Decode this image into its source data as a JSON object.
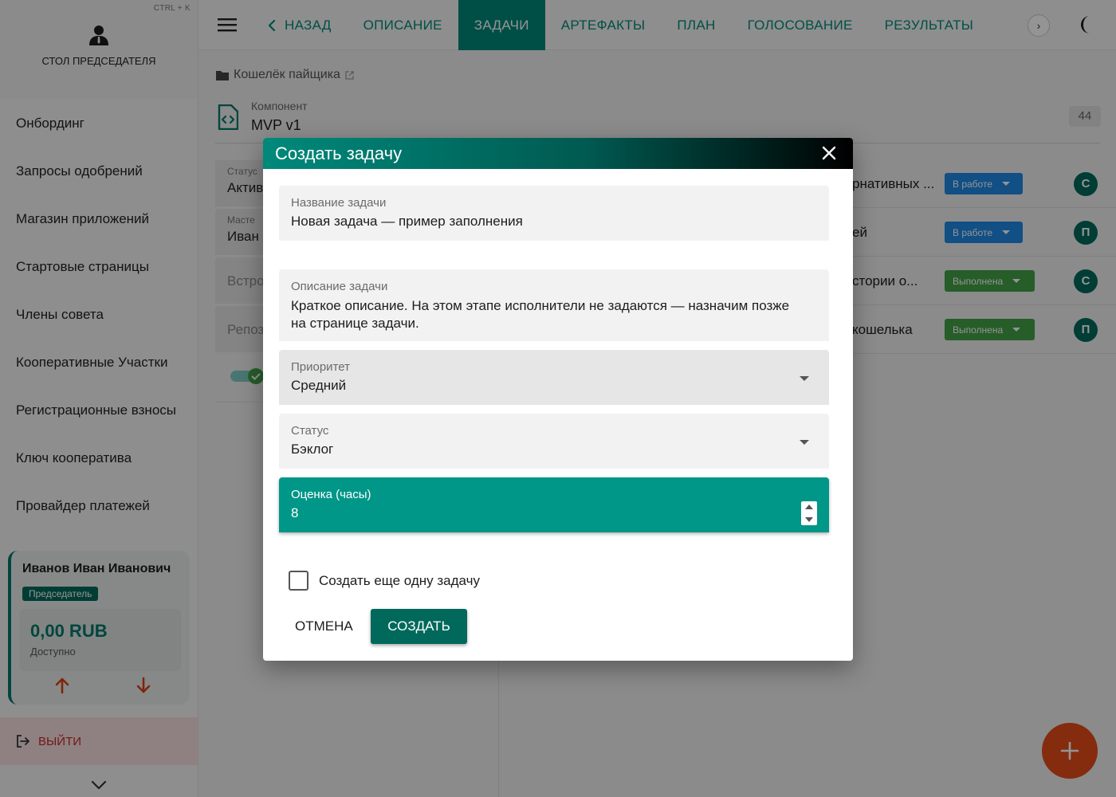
{
  "sidebar": {
    "shortcut": "CTRL + K",
    "title": "СТОЛ ПРЕДСЕДАТЕЛЯ",
    "items": [
      {
        "label": "Онбординг"
      },
      {
        "label": "Запросы одобрений"
      },
      {
        "label": "Магазин приложений"
      },
      {
        "label": "Стартовые страницы"
      },
      {
        "label": "Члены совета"
      },
      {
        "label": "Кооперативные Участки"
      },
      {
        "label": "Регистрационные взносы"
      },
      {
        "label": "Ключ кооператива"
      },
      {
        "label": "Провайдер платежей"
      }
    ],
    "user": {
      "name": "Иванов Иван Иванович",
      "role": "Председатель",
      "amount": "0,00 RUB",
      "available": "Доступно"
    },
    "logout": "ВЫЙТИ"
  },
  "topbar": {
    "back": "НАЗАД",
    "tabs": [
      {
        "label": "ОПИСАНИЕ"
      },
      {
        "label": "ЗАДАЧИ"
      },
      {
        "label": "АРТЕФАКТЫ"
      },
      {
        "label": "ПЛАН"
      },
      {
        "label": "ГОЛОСОВАНИЕ"
      },
      {
        "label": "РЕЗУЛЬТАТЫ"
      }
    ],
    "active_tab": "ЗАДАЧИ",
    "more": "›"
  },
  "content": {
    "breadcrumb": "Кошелёк пайщика",
    "component_label": "Компонент",
    "component_value": "MVP v1",
    "component_count": "44",
    "left_fields": [
      {
        "label": "Статус",
        "value": "Актив"
      },
      {
        "label": "Масте",
        "value": "Иван"
      },
      {
        "placeholder": "Встро"
      },
      {
        "placeholder": "Репоз"
      }
    ],
    "tasks": [
      {
        "title": "рнативных ...",
        "status": "В работе",
        "avatar": "С"
      },
      {
        "title": "ей",
        "status": "В работе",
        "avatar": "П"
      },
      {
        "title": "стории о...",
        "status": "Выполнена",
        "avatar": "С"
      },
      {
        "title": "кошелька",
        "status": "Выполнена",
        "avatar": "П"
      }
    ]
  },
  "dialog": {
    "title": "Создать задачу",
    "name": {
      "label": "Название задачи",
      "value": "Новая задача — пример заполнения"
    },
    "description": {
      "label": "Описание задачи",
      "value": "Краткое описание. На этом этапе исполнители не задаются — назначим позже на странице задачи."
    },
    "priority": {
      "label": "Приоритет",
      "value": "Средний"
    },
    "status": {
      "label": "Статус",
      "value": "Бэклог"
    },
    "estimate": {
      "label": "Оценка (часы)",
      "value": "8"
    },
    "create_another": "Создать еще одну задачу",
    "cancel": "ОТМЕНА",
    "create": "СОЗДАТЬ"
  },
  "colors": {
    "accent": "#00897b",
    "accent_dark": "#00695c",
    "status_in_work": "#1e88e5",
    "status_done": "#43a047",
    "fab": "#e64a19",
    "logout_text": "#c62828"
  }
}
